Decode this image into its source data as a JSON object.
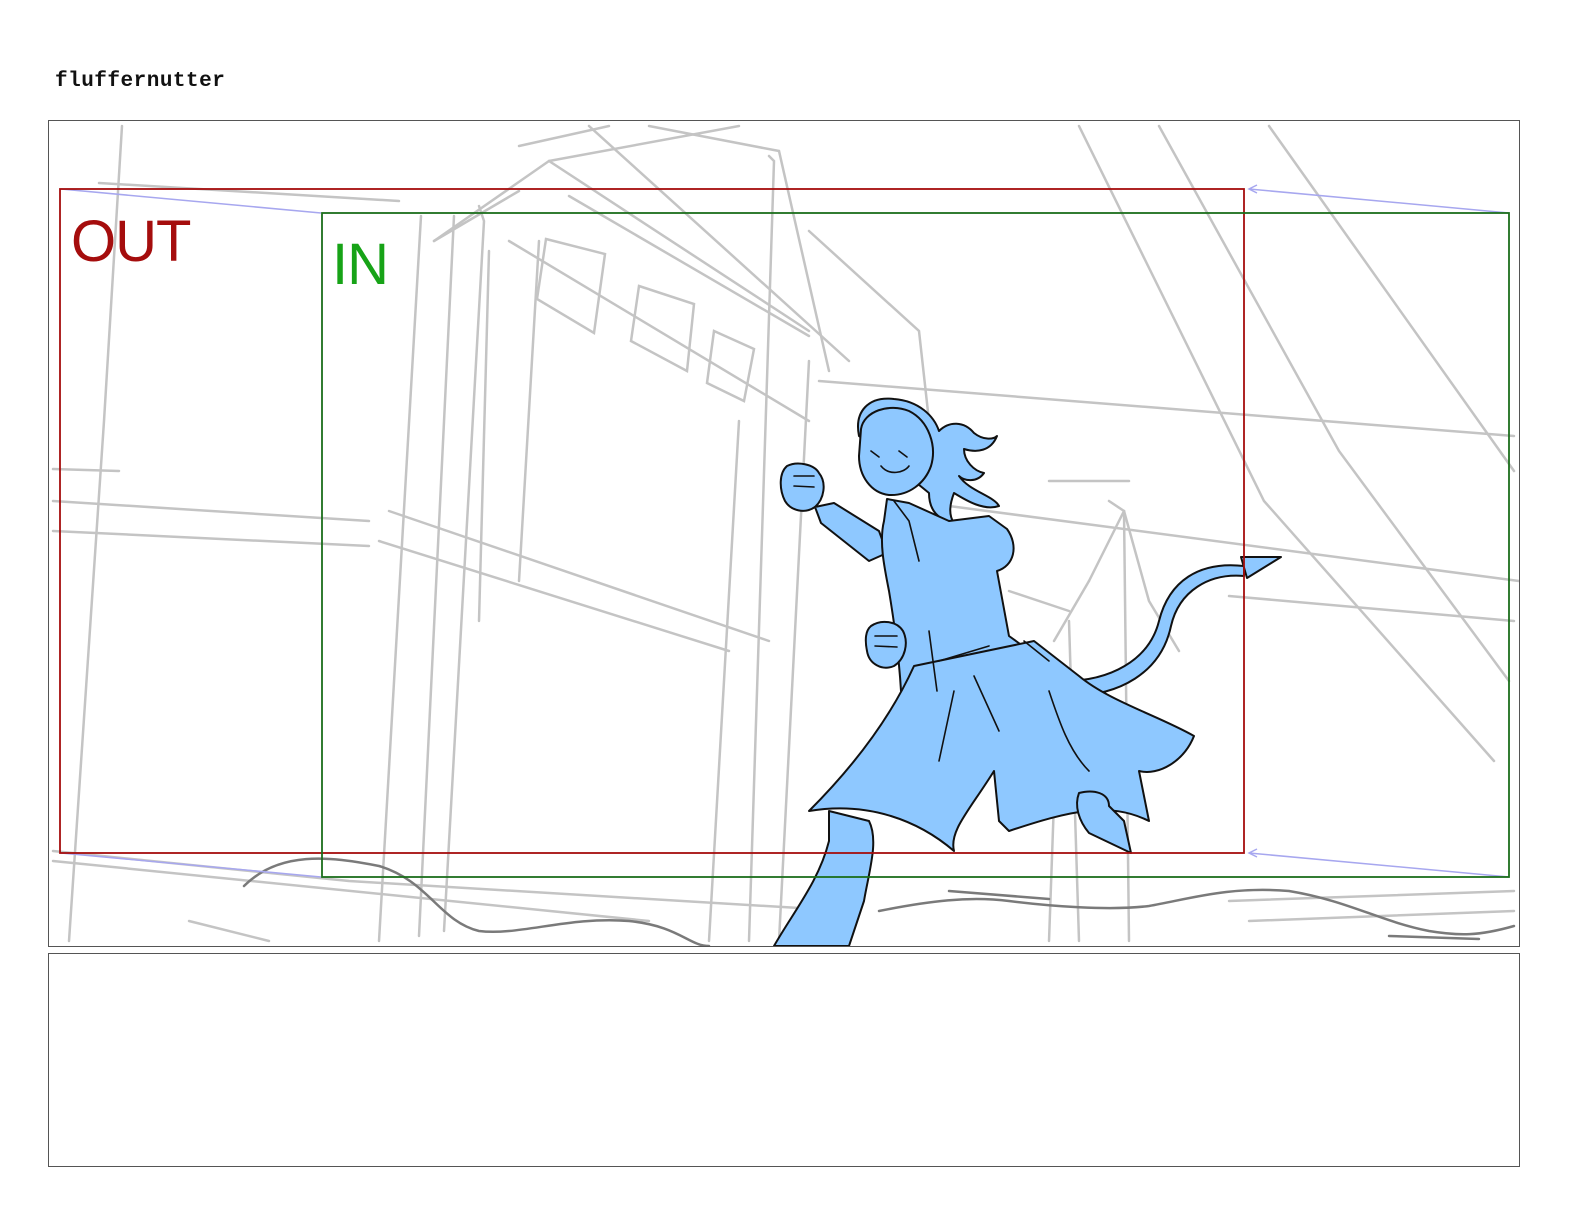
{
  "board": {
    "title": "fluffernutter"
  },
  "panel": {
    "out_frame_label": "OUT",
    "in_frame_label": "IN",
    "colors": {
      "out_frame": "#a50d0d",
      "in_frame": "#1b6e1b",
      "in_label": "#17a317",
      "character_fill": "#8ec8ff",
      "sketch_lines": "#c4c4c4",
      "camera_move_arrows": "#a7a7ef"
    }
  },
  "notes": {
    "text": ""
  }
}
